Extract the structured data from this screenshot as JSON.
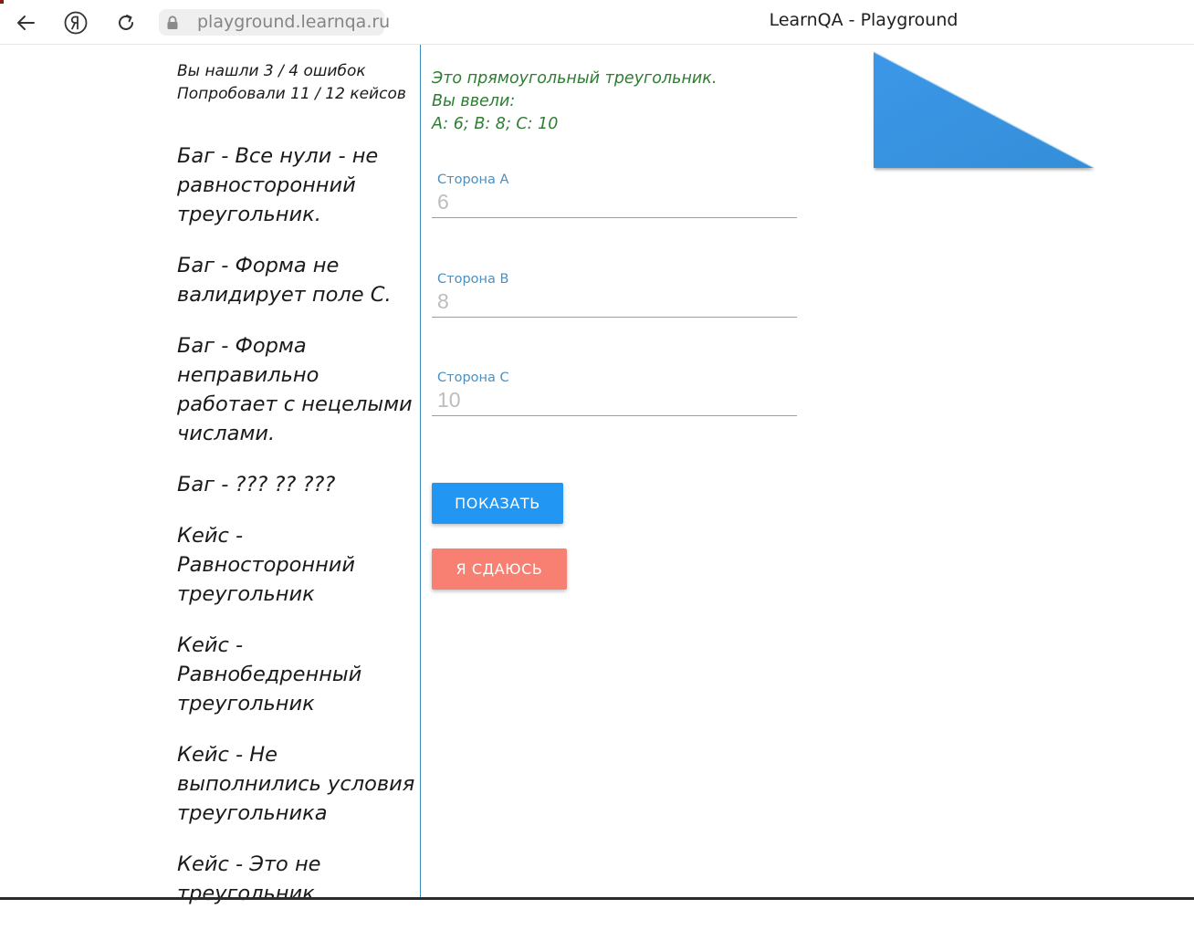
{
  "browser": {
    "url": "playground.learnqa.ru",
    "tab_title": "LearnQA - Playground",
    "icons": {
      "back": "back-arrow-icon",
      "yandex": "yandex-logo-icon",
      "reload": "reload-icon",
      "lock": "lock-icon"
    }
  },
  "summary": {
    "errors_found": "Вы нашли 3 / 4 ошибок",
    "cases_tried": "Попробовали 11 / 12 кейсов"
  },
  "cases": [
    "Баг - Все нули - не равносторонний треугольник.",
    "Баг - Форма не валидирует поле С.",
    "Баг - Форма неправильно работает с нецелыми числами.",
    "Баг - ??? ?? ???",
    "Кейс - Равносторонний треугольник",
    "Кейс - Равнобедренный треугольник",
    "Кейс - Не выполнились условия треугольника",
    "Кейс - Это не треугольник"
  ],
  "result": {
    "line1": "Это прямоугольный треугольник.",
    "line2": "Вы ввели:",
    "line3": "A: 6; B: 8; C: 10",
    "color": "#2e7d32"
  },
  "form": {
    "side_a": {
      "label": "Сторона А",
      "value": "6"
    },
    "side_b": {
      "label": "Сторона В",
      "value": "8"
    },
    "side_c": {
      "label": "Сторона С",
      "value": "10"
    }
  },
  "buttons": {
    "show_label": "Показать",
    "give_up_label": "Я сдаюсь"
  },
  "colors": {
    "primary": "#2196f3",
    "danger": "#f78072",
    "triangle": "#3a96e6",
    "divider": "#3a8fc0",
    "label": "#4a90c2"
  }
}
